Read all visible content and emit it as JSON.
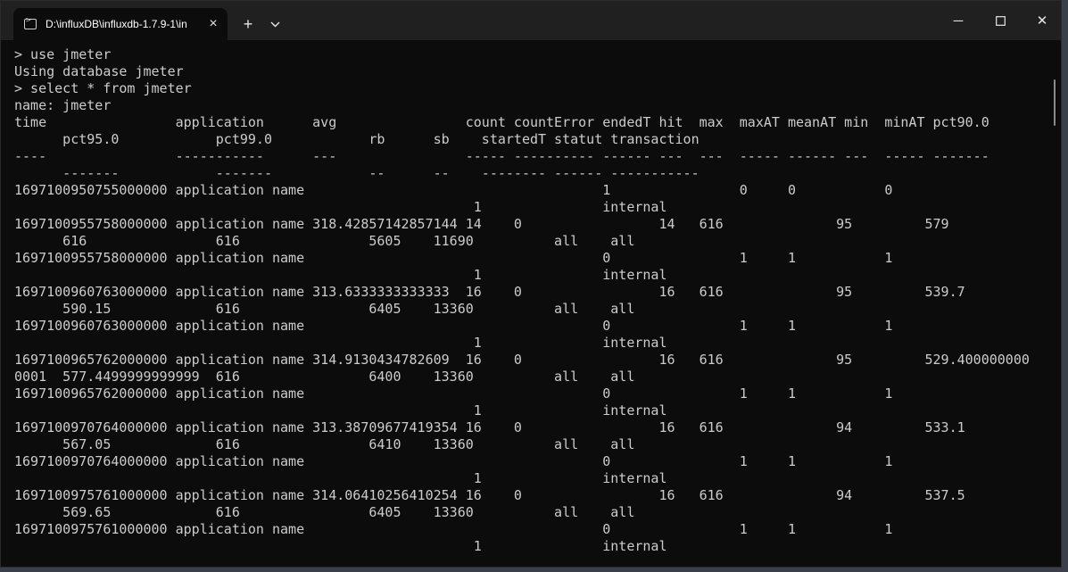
{
  "window": {
    "tab_title": "D:\\influxDB\\influxdb-1.7.9-1\\in",
    "tab_close_icon": "×",
    "new_tab_icon": "+",
    "dropdown_icon": "chevron-down",
    "minimize_icon": "─",
    "maximize_icon": "☐",
    "close_icon": "✕"
  },
  "terminal": {
    "lines": [
      "> use jmeter",
      "Using database jmeter",
      "> select * from jmeter",
      "name: jmeter",
      "time                application      avg                count countError endedT hit  max  maxAT meanAT min  minAT pct90.0",
      "      pct95.0            pct99.0            rb      sb    startedT statut transaction",
      "----                -----------      ---                ----- ---------- ------ ---  ---  ----- ------ ---  ----- -------",
      "      -------            -------            --      --    -------- ------ -----------",
      "1697100950755000000 application name                                     1                0     0           0",
      "                                                         1               internal",
      "1697100955758000000 application name 318.42857142857144 14    0                 14   616              95         579",
      "      616                616                5605    11690          all    all",
      "1697100955758000000 application name                                     0                1     1           1",
      "                                                         1               internal",
      "1697100960763000000 application name 313.6333333333333  16    0                 16   616              95         539.7",
      "      590.15             616                6405    13360          all    all",
      "1697100960763000000 application name                                     0                1     1           1",
      "                                                         1               internal",
      "1697100965762000000 application name 314.9130434782609  16    0                 16   616              95         529.400000000",
      "0001  577.4499999999999  616                6400    13360          all    all",
      "1697100965762000000 application name                                     0                1     1           1",
      "                                                         1               internal",
      "1697100970764000000 application name 313.38709677419354 16    0                 16   616              94         533.1",
      "      567.05             616                6410    13360          all    all",
      "1697100970764000000 application name                                     0                1     1           1",
      "                                                         1               internal",
      "1697100975761000000 application name 314.06410256410254 16    0                 16   616              94         537.5",
      "      569.65             616                6405    13360          all    all",
      "1697100975761000000 application name                                     0                1     1           1",
      "                                                         1               internal"
    ]
  },
  "colors": {
    "background": "#0c0c0c",
    "titlebar": "#202020",
    "text": "#cccccc"
  }
}
